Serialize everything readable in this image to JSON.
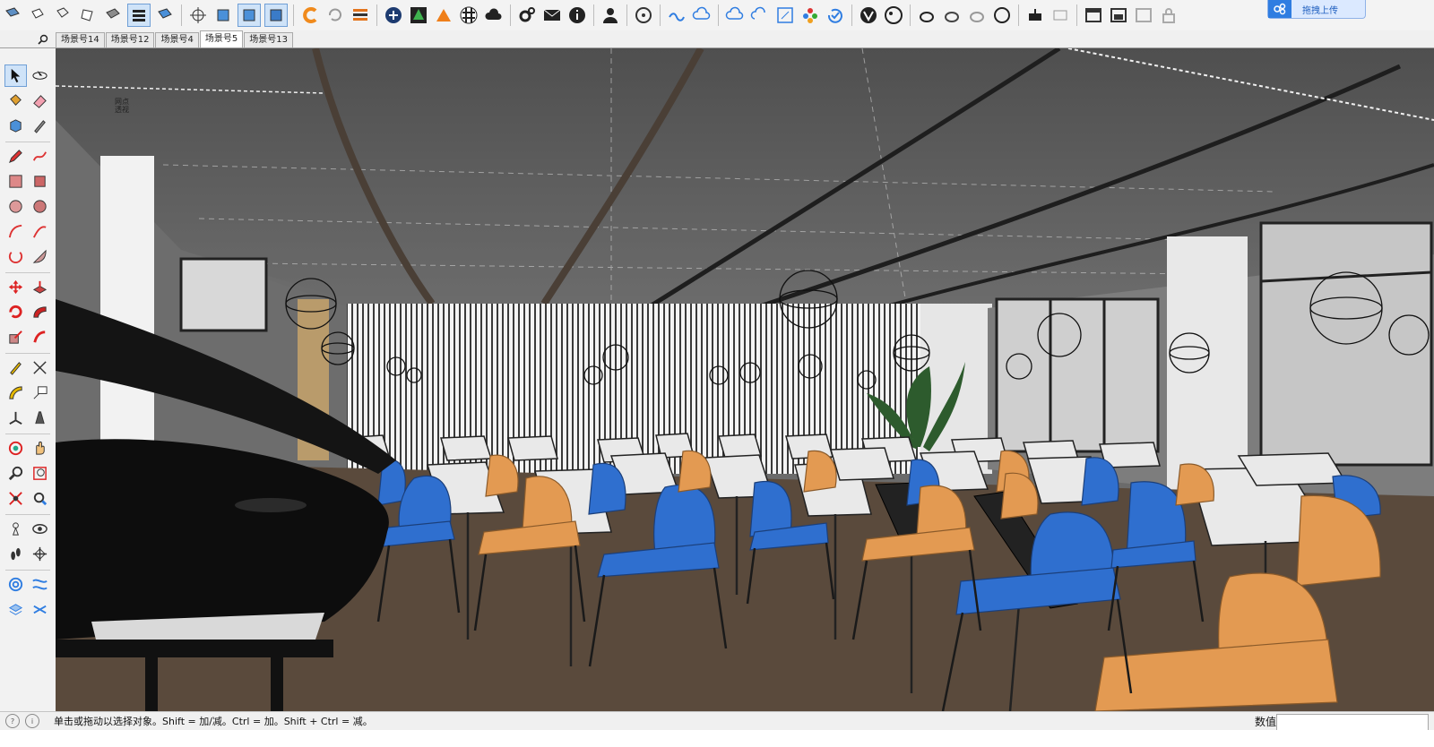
{
  "toolbar": {
    "upload_label": "拖拽上传"
  },
  "scene_tabs": [
    {
      "label": "场景号14"
    },
    {
      "label": "场景号12"
    },
    {
      "label": "场景号4"
    },
    {
      "label": "场景号5",
      "active": true
    },
    {
      "label": "场景号13"
    }
  ],
  "viewport": {
    "axis_label_line1": "网点",
    "axis_label_line2": "透视"
  },
  "statusbar": {
    "hint": "单击或拖动以选择对象。Shift = 加/减。Ctrl = 加。Shift + Ctrl = 减。",
    "measure_label": "数值",
    "measure_value": ""
  },
  "colors": {
    "ceiling": "#5e5e5e",
    "floor": "#5a4a3c",
    "chair_blue": "#2f6fcf",
    "chair_orange": "#e39a52",
    "wall_white": "#eeeeee",
    "accent": "#2f7de1"
  }
}
